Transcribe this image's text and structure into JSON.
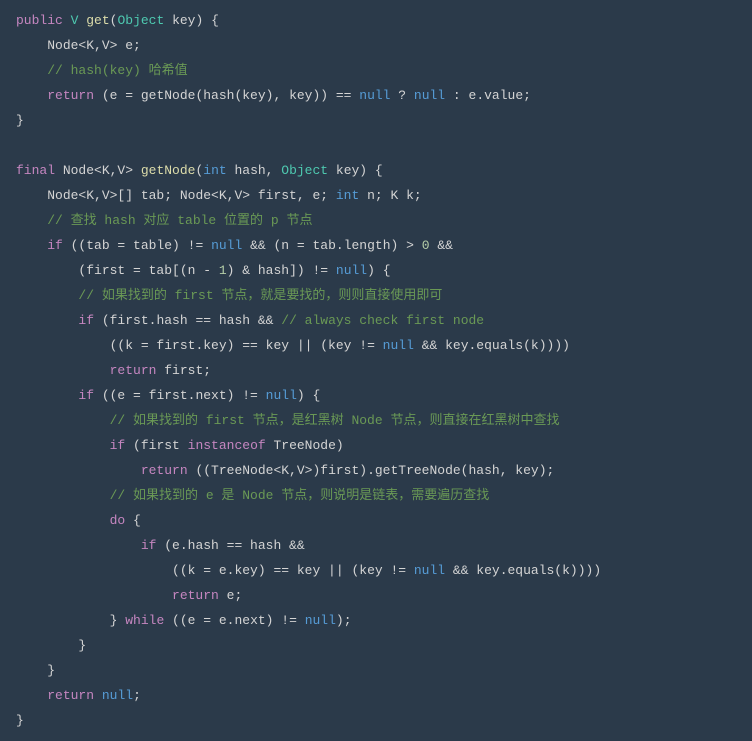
{
  "code": {
    "l1_kw_public": "public",
    "l1_type_v": "V",
    "l1_method": "get",
    "l1_type_obj": "Object",
    "l1_txt": " key) {",
    "l2_txt": "Node<K,V> e;",
    "l3_comment": "// hash(key) 哈希值",
    "l4_kw": "return",
    "l4_txt1": " (e = getNode(hash(key), key)) == ",
    "l4_null1": "null",
    "l4_txt2": " ? ",
    "l4_null2": "null",
    "l4_txt3": " : e.value;",
    "l5_txt": "}",
    "l7_kw": "final",
    "l7_txt1": " Node<K,V> ",
    "l7_method": "getNode",
    "l7_txt2": "(",
    "l7_int": "int",
    "l7_txt3": " hash, ",
    "l7_type_obj": "Object",
    "l7_txt4": " key) {",
    "l8_txt1": "Node<K,V>[] tab; Node<K,V> first, e; ",
    "l8_int": "int",
    "l8_txt2": " n; K k;",
    "l9_comment": "// 查找 hash 对应 table 位置的 p 节点",
    "l10_kw": "if",
    "l10_txt1": " ((tab = table) != ",
    "l10_null": "null",
    "l10_txt2": " && (n = tab.length) > ",
    "l10_num": "0",
    "l10_txt3": " &&",
    "l11_txt1": "(first = tab[(n - ",
    "l11_num": "1",
    "l11_txt2": ") & hash]) != ",
    "l11_null": "null",
    "l11_txt3": ") {",
    "l12_comment": "// 如果找到的 first 节点，就是要找的，则则直接使用即可",
    "l13_kw": "if",
    "l13_txt1": " (first.hash == hash && ",
    "l13_comment": "// always check first node",
    "l14_txt1": "((k = first.key) == key || (key != ",
    "l14_null": "null",
    "l14_txt2": " && key.equals(k))))",
    "l15_kw": "return",
    "l15_txt": " first;",
    "l16_kw": "if",
    "l16_txt1": " ((e = first.next) != ",
    "l16_null": "null",
    "l16_txt2": ") {",
    "l17_comment": "// 如果找到的 first 节点，是红黑树 Node 节点，则直接在红黑树中查找",
    "l18_kw": "if",
    "l18_txt1": " (first ",
    "l18_inst": "instanceof",
    "l18_txt2": " TreeNode)",
    "l19_kw": "return",
    "l19_txt": " ((TreeNode<K,V>)first).getTreeNode(hash, key);",
    "l20_comment": "// 如果找到的 e 是 Node 节点，则说明是链表，需要遍历查找",
    "l21_kw": "do",
    "l21_txt": " {",
    "l22_kw": "if",
    "l22_txt": " (e.hash == hash &&",
    "l23_txt1": "((k = e.key) == key || (key != ",
    "l23_null": "null",
    "l23_txt2": " && key.equals(k))))",
    "l24_kw": "return",
    "l24_txt": " e;",
    "l25_txt1": "} ",
    "l25_kw": "while",
    "l25_txt2": " ((e = e.next) != ",
    "l25_null": "null",
    "l25_txt3": ");",
    "l26_txt": "}",
    "l27_txt": "}",
    "l28_kw": "return",
    "l28_txt": " ",
    "l28_null": "null",
    "l28_txt2": ";",
    "l29_txt": "}"
  }
}
